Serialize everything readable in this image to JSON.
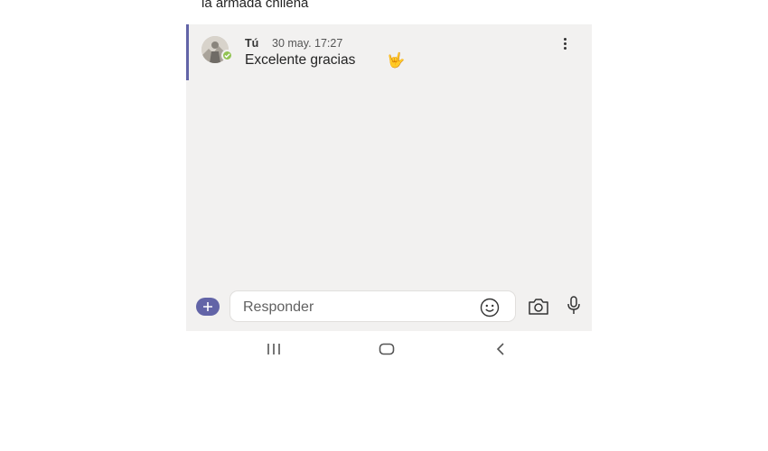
{
  "previous_message": {
    "text": "la armada chilena"
  },
  "message": {
    "sender": "Tú",
    "timestamp": "30 may. 17:27",
    "text": "Excelente gracias",
    "emoji": "🤟",
    "avatar_icon": "user-avatar-icon",
    "presence_icon": "available-check-icon",
    "more_icon": "more-vertical-icon"
  },
  "composer": {
    "add_icon": "plus-icon",
    "placeholder": "Responder",
    "emoji_icon": "smiley-icon",
    "camera_icon": "camera-icon",
    "mic_icon": "microphone-icon"
  },
  "navbar": {
    "recent_icon": "recent-apps-icon",
    "home_icon": "home-icon",
    "back_icon": "back-icon"
  },
  "colors": {
    "accent": "#6264a7",
    "chat_background": "#f2f1f0",
    "presence_available": "#92c353"
  }
}
